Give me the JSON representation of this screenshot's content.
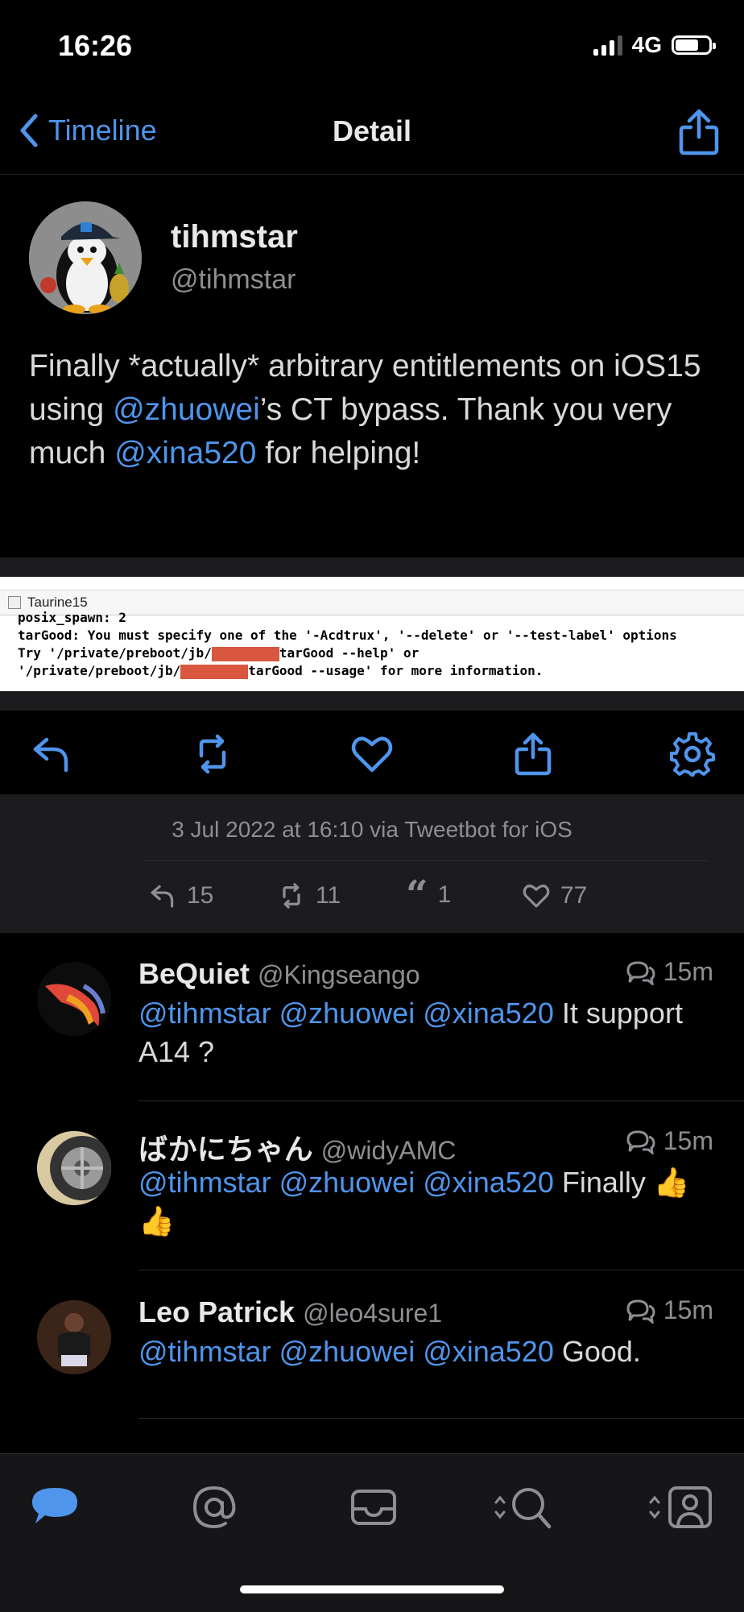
{
  "status_bar": {
    "time": "16:26",
    "network": "4G"
  },
  "nav": {
    "back_label": "Timeline",
    "title": "Detail"
  },
  "tweet": {
    "display_name": "tihmstar",
    "handle": "@tihmstar",
    "text_parts": [
      "Finally *actually* arbitrary entitlements on iOS15 using ",
      "@zhuowei",
      "’s CT bypass. Thank you very much ",
      "@xina520",
      " for helping!"
    ],
    "date_line": "3 Jul 2022 at 16:10 via Tweetbot for iOS",
    "stats": {
      "replies": "15",
      "retweets": "11",
      "quotes": "1",
      "likes": "77"
    }
  },
  "media": {
    "window_title": "Taurine15",
    "lines": [
      "posix_spawn: 2",
      "tarGood: You must specify one of the '-Acdtrux', '--delete' or '--test-label' options",
      "Try '/private/preboot/jb/",
      "tarGood --help' or",
      "'/private/preboot/jb/",
      "tarGood --usage' for more information."
    ]
  },
  "replies": [
    {
      "name": "BeQuiet",
      "handle": "@Kingseango",
      "time": "15m",
      "mentions": "@tihmstar @zhuowei @xina520",
      "text": " It support A14 ?"
    },
    {
      "name": "ばかにちゃん",
      "handle": "@widyAMC",
      "time": "15m",
      "mentions": "@tihmstar @zhuowei @xina520",
      "text": " Finally 👍👍"
    },
    {
      "name": "Leo Patrick",
      "handle": "@leo4sure1",
      "time": "15m",
      "mentions": "@tihmstar @zhuowei @xina520",
      "text": " Good."
    }
  ],
  "icons": {
    "nav": [
      "chevron-left-icon",
      "share-icon"
    ],
    "actions": [
      "reply-icon",
      "retweet-icon",
      "heart-icon",
      "share-icon",
      "gear-icon"
    ],
    "tabs": [
      "speech-bubble-icon",
      "at-sign-icon",
      "envelope-icon",
      "search-icon",
      "profile-icon"
    ]
  },
  "colors": {
    "accent": "#4f95ec",
    "background": "#000000",
    "panel": "#1c1c1e",
    "secondary_text": "#8e8e93"
  }
}
